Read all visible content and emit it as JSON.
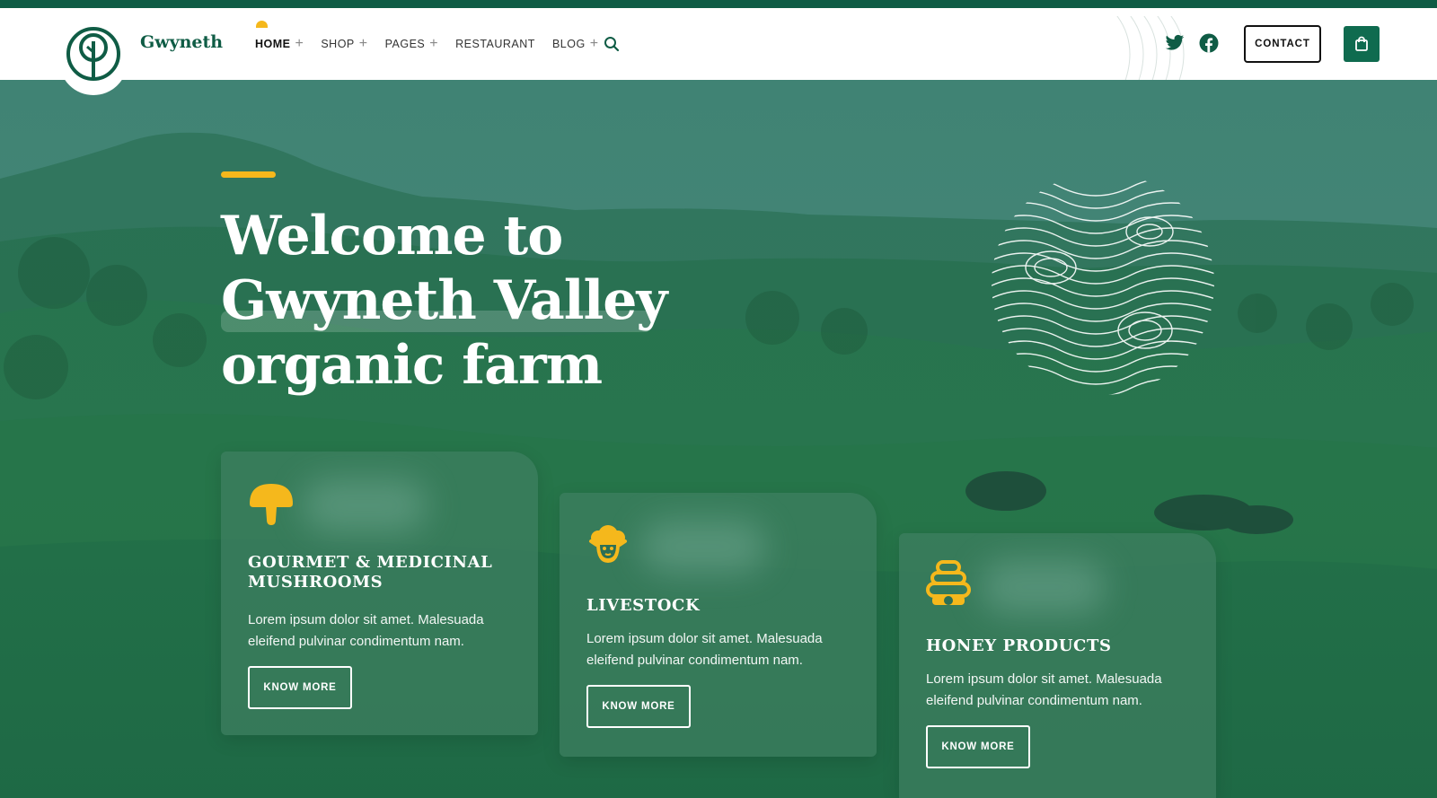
{
  "brand": {
    "name": "Gwyneth"
  },
  "nav": {
    "items": [
      {
        "label": "HOME",
        "has_submenu": true,
        "active": true
      },
      {
        "label": "SHOP",
        "has_submenu": true
      },
      {
        "label": "PAGES",
        "has_submenu": true
      },
      {
        "label": "RESTAURANT",
        "has_submenu": false
      },
      {
        "label": "BLOG",
        "has_submenu": true
      }
    ],
    "submenu_symbol": "+",
    "search_icon": "search-icon"
  },
  "header_actions": {
    "social": [
      "twitter-icon",
      "facebook-icon"
    ],
    "contact_label": "CONTACT",
    "cart_icon": "shopping-bag-icon"
  },
  "hero": {
    "title_lines": [
      "Welcome to",
      "Gwyneth Valley",
      "organic farm"
    ]
  },
  "cards": [
    {
      "icon": "mushroom-icon",
      "title": "GOURMET & MEDICINAL MUSHROOMS",
      "text": "Lorem ipsum dolor sit amet. Malesuada eleifend pulvinar condimentum nam.",
      "button": "KNOW MORE"
    },
    {
      "icon": "sheep-icon",
      "title": "LIVESTOCK",
      "text": "Lorem ipsum dolor sit amet. Malesuada eleifend pulvinar condimentum nam.",
      "button": "KNOW MORE"
    },
    {
      "icon": "beehive-icon",
      "title": "HONEY PRODUCTS",
      "text": "Lorem ipsum dolor sit amet. Malesuada eleifend pulvinar condimentum nam.",
      "button": "KNOW MORE"
    }
  ],
  "colors": {
    "brand_green": "#0f5c45",
    "accent_yellow": "#f5b81c",
    "hero_overlay": "#2a7a4c"
  }
}
